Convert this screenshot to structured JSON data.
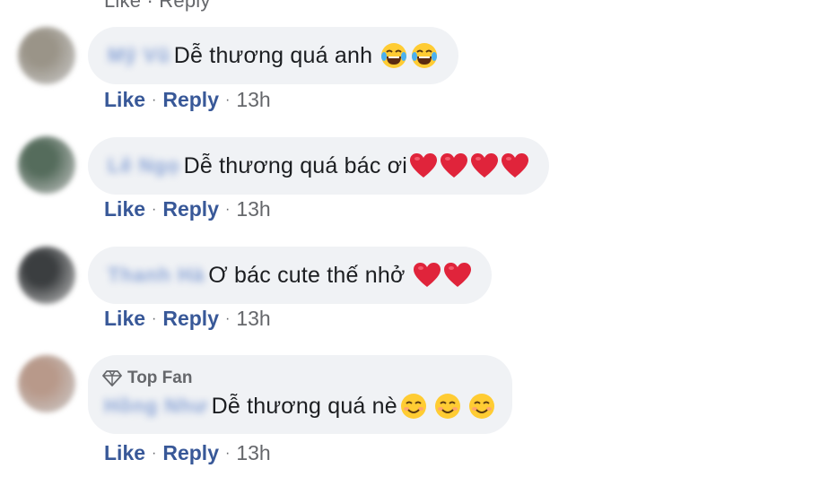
{
  "top_partial_text": "Like · Reply",
  "actions": {
    "like": "Like",
    "reply": "Reply",
    "separator": "·"
  },
  "comments": [
    {
      "name_blur": "Mỹ Vũ",
      "text": "Dễ thương quá anh",
      "time": "13h",
      "avatar_color": "#9a9488",
      "emoji": [
        "laugh-tears-icon",
        "laugh-tears-icon"
      ]
    },
    {
      "name_blur": "Lê Ngọ",
      "text": "Dễ thương quá bác ơi",
      "time": "13h",
      "avatar_color": "#556c5c",
      "emoji": [
        "heart-icon",
        "heart-icon",
        "heart-icon",
        "heart-icon"
      ]
    },
    {
      "name_blur": "Thanh Hà",
      "text": "Ơ bác cute thế nhở",
      "time": "13h",
      "avatar_color": "#3b3e40",
      "emoji": [
        "heart-icon",
        "heart-icon"
      ]
    },
    {
      "badge": "Top Fan",
      "name_blur": "Hồng Như",
      "text": "Dễ thương quá nè",
      "time": "13h",
      "avatar_color": "#b8998a",
      "emoji": [
        "smile-icon",
        "smile-icon",
        "smile-icon"
      ]
    }
  ]
}
